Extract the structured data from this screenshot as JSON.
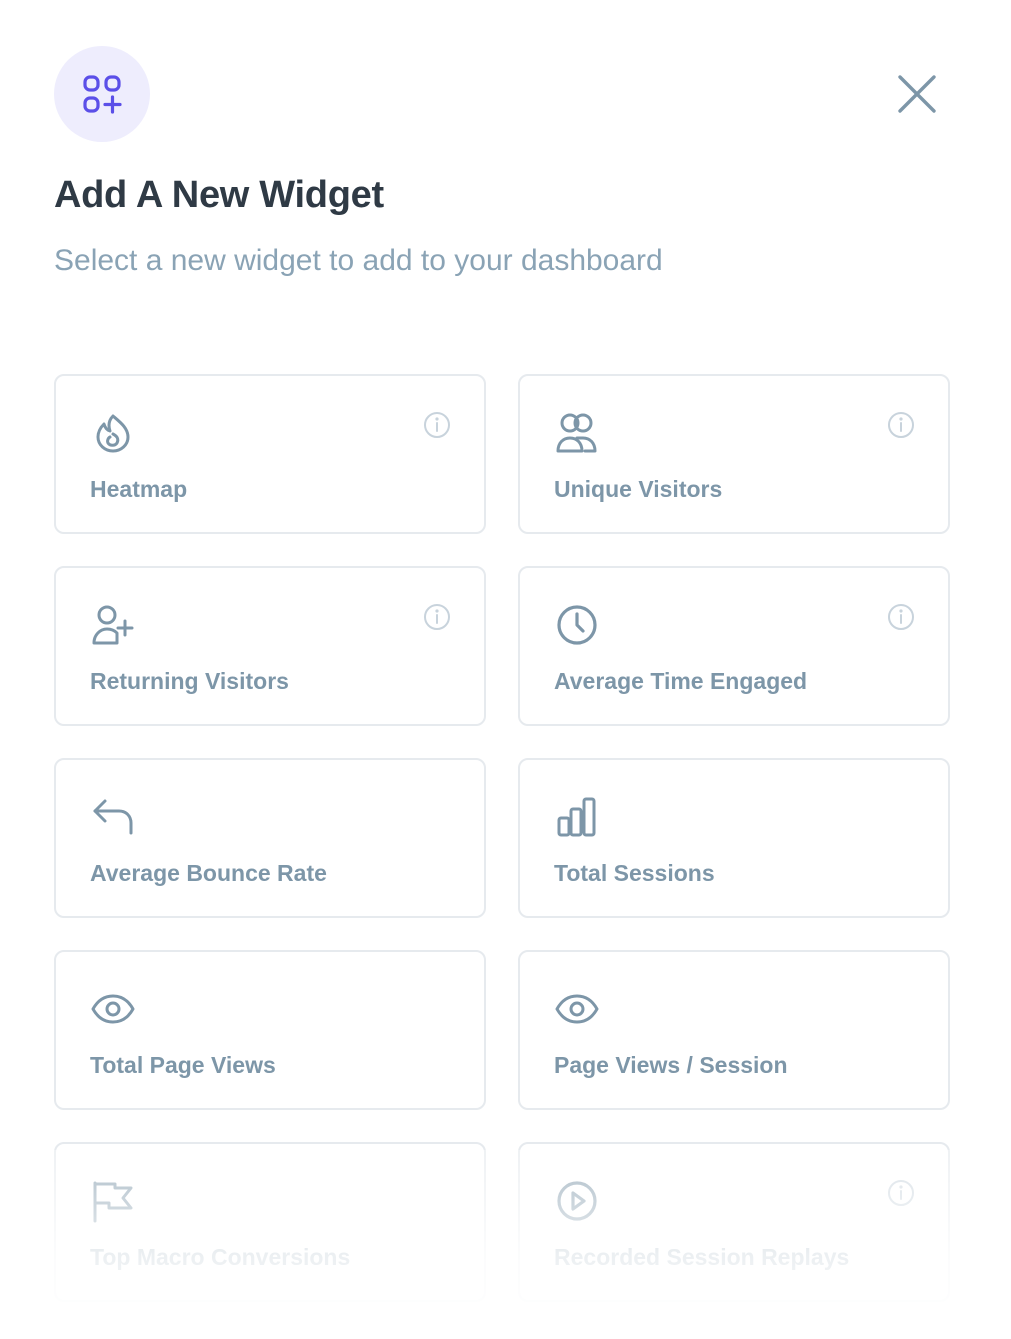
{
  "header": {
    "icon": "widgets-add-icon",
    "title": "Add A New Widget",
    "subtitle": "Select a new widget to add to your dashboard",
    "close_icon": "close-icon"
  },
  "colors": {
    "accent": "#5b4fe8",
    "accent_bg": "#eeedfd",
    "title": "#2f3a45",
    "muted": "#8aa3b5",
    "label": "#7d96a8",
    "border": "#e6eaee"
  },
  "widgets": [
    {
      "label": "Heatmap",
      "icon": "flame-icon",
      "info": true
    },
    {
      "label": "Unique Visitors",
      "icon": "users-icon",
      "info": true
    },
    {
      "label": "Returning Visitors",
      "icon": "user-plus-icon",
      "info": true
    },
    {
      "label": "Average Time Engaged",
      "icon": "clock-icon",
      "info": true
    },
    {
      "label": "Average Bounce Rate",
      "icon": "reply-arrow-icon",
      "info": false
    },
    {
      "label": "Total Sessions",
      "icon": "bar-chart-icon",
      "info": false
    },
    {
      "label": "Total Page Views",
      "icon": "eye-icon",
      "info": false
    },
    {
      "label": "Page Views / Session",
      "icon": "eye-icon",
      "info": false
    },
    {
      "label": "Top Macro Conversions",
      "icon": "flag-icon",
      "info": false
    },
    {
      "label": "Recorded Session Replays",
      "icon": "play-circle-icon",
      "info": true
    }
  ]
}
